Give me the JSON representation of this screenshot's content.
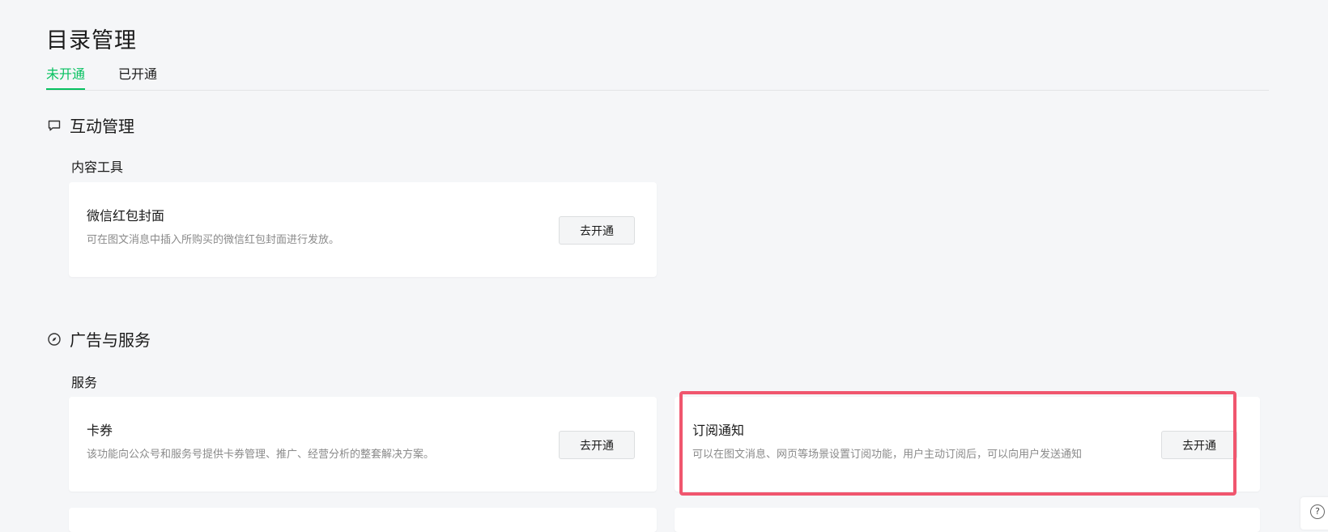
{
  "page": {
    "title": "目录管理"
  },
  "tabs": [
    {
      "label": "未开通",
      "active": true
    },
    {
      "label": "已开通",
      "active": false
    }
  ],
  "sections": [
    {
      "title": "互动管理",
      "icon": "chat-bubble-icon",
      "subtitle": "内容工具",
      "cards": [
        {
          "title": "微信红包封面",
          "description": "可在图文消息中插入所购买的微信红包封面进行发放。",
          "button": "去开通"
        }
      ]
    },
    {
      "title": "广告与服务",
      "icon": "compass-icon",
      "subtitle": "服务",
      "cards": [
        {
          "title": "卡券",
          "description": "该功能向公众号和服务号提供卡券管理、推广、经营分析的整套解决方案。",
          "button": "去开通"
        },
        {
          "title": "订阅通知",
          "description": "可以在图文消息、网页等场景设置订阅功能，用户主动订阅后，可以向用户发送通知",
          "button": "去开通"
        }
      ]
    }
  ],
  "help": {
    "icon": "help-icon",
    "glyph": "?"
  },
  "colors": {
    "accent": "#07c160",
    "highlight": "#f0566e",
    "background": "#f5f6f8"
  }
}
